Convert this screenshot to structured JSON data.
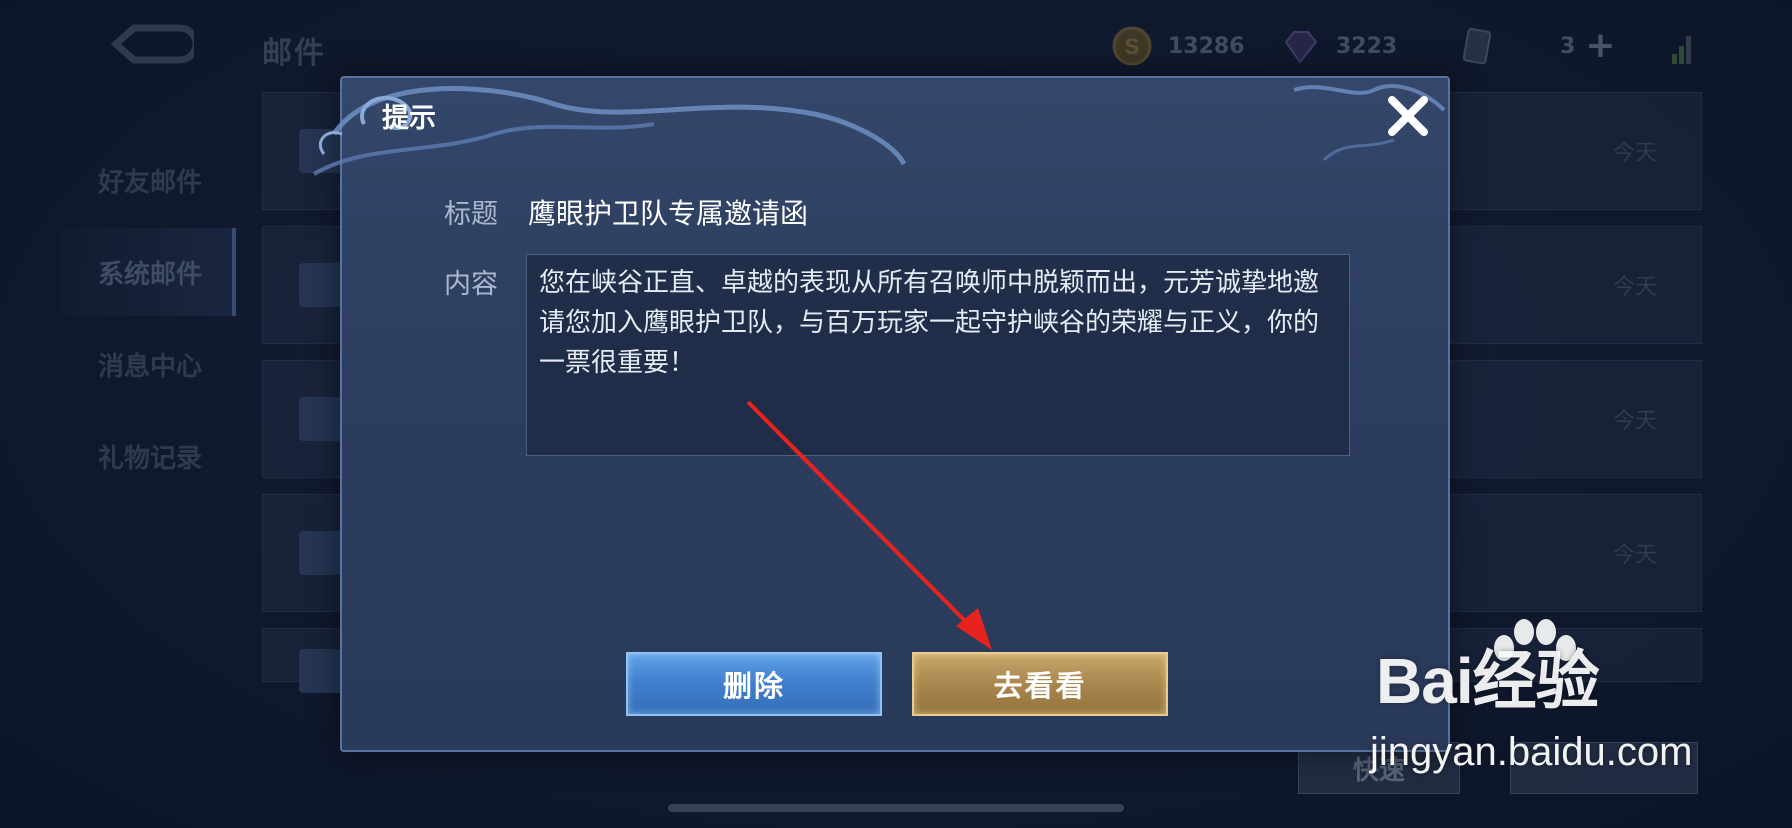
{
  "header": {
    "title": "邮件",
    "currencies": [
      {
        "icon": "gold-coin-icon",
        "value": "13286"
      },
      {
        "icon": "gem-icon",
        "value": "3223"
      },
      {
        "icon": "card-icon",
        "value": ""
      },
      {
        "icon": "plus-icon",
        "value": "3"
      }
    ]
  },
  "sidebar": {
    "items": [
      {
        "label": "好友邮件",
        "active": false
      },
      {
        "label": "系统邮件",
        "active": true
      },
      {
        "label": "消息中心",
        "active": false
      },
      {
        "label": "礼物记录",
        "active": false
      }
    ]
  },
  "mail_list": {
    "dates": [
      "今天",
      "今天",
      "今天",
      "今天",
      ""
    ]
  },
  "footer": {
    "quick_label": "快速",
    "right_label": ""
  },
  "dialog": {
    "title": "提示",
    "subject_label": "标题",
    "subject": "鹰眼护卫队专属邀请函",
    "content_label": "内容",
    "content": "您在峡谷正直、卓越的表现从所有召唤师中脱颖而出，元芳诚挚地邀请您加入鹰眼护卫队，与百万玩家一起守护峡谷的荣耀与正义，你的一票很重要！",
    "delete_label": "删除",
    "go_label": "去看看"
  },
  "watermark": {
    "brand": "Bai经验",
    "url": "jingyan.baidu.com"
  },
  "colors": {
    "delete_button": "#4a8ad8",
    "go_button": "#b08e55",
    "annotation_arrow": "#e8231f"
  }
}
